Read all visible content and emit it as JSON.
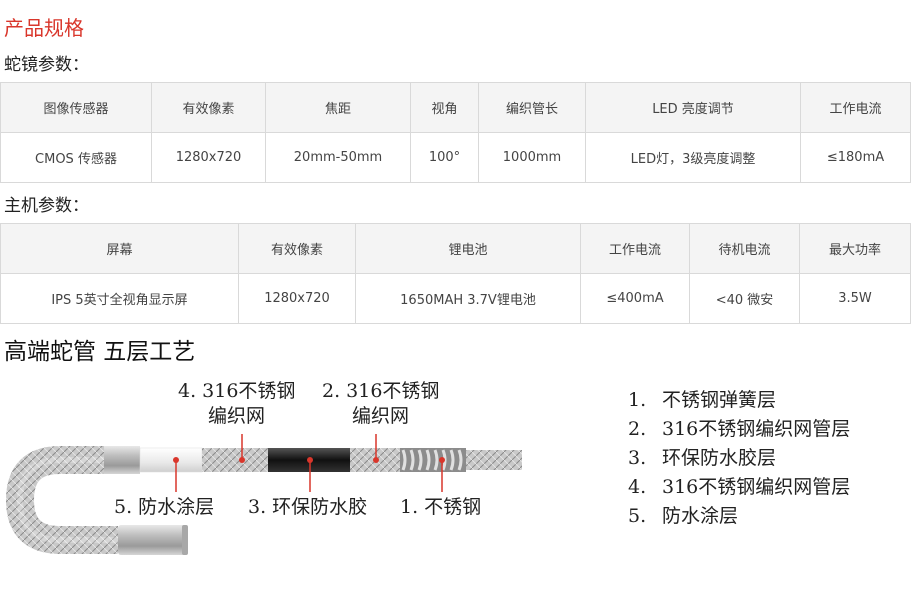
{
  "page": {
    "title": "产品规格"
  },
  "probe": {
    "label": "蛇镜参数：",
    "headers": [
      "图像传感器",
      "有效像素",
      "焦距",
      "视角",
      "编织管长",
      "LED 亮度调节",
      "工作电流"
    ],
    "row": [
      "CMOS 传感器",
      "1280x720",
      "20mm-50mm",
      "100°",
      "1000mm",
      "LED灯，3级亮度调整",
      "≤180mA"
    ]
  },
  "host": {
    "label": "主机参数：",
    "headers": [
      "屏幕",
      "有效像素",
      "锂电池",
      "工作电流",
      "待机电流",
      "最大功率"
    ],
    "row": [
      "IPS 5英寸全视角显示屏",
      "1280x720",
      "1650MAH 3.7V锂电池",
      "≤400mA",
      "<40 微安",
      "3.5W"
    ]
  },
  "tube": {
    "heading": "高端蛇管 五层工艺",
    "callouts": {
      "top_left_line1": "4. 316不锈钢",
      "top_left_line2": "编织网",
      "top_right_line1": "2. 316不锈钢",
      "top_right_line2": "编织网",
      "bottom_1": "5. 防水涂层",
      "bottom_2": "3. 环保防水胶",
      "bottom_3": "1. 不锈钢"
    },
    "legend": [
      {
        "num": "1.",
        "text": "不锈钢弹簧层"
      },
      {
        "num": "2.",
        "text": "316不锈钢编织网管层"
      },
      {
        "num": "3.",
        "text": "环保防水胶层"
      },
      {
        "num": "4.",
        "text": "316不锈钢编织网管层"
      },
      {
        "num": "5.",
        "text": "防水涂层"
      }
    ]
  },
  "colors": {
    "accent": "#d9362b",
    "header_bg": "#f4f4f4",
    "border": "#d9d9d9"
  }
}
